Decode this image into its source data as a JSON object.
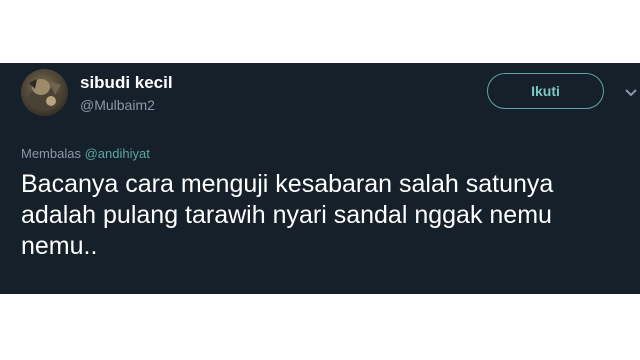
{
  "tweet": {
    "author": {
      "display_name": "sibudi kecil",
      "handle": "@Mulbaim2"
    },
    "follow_label": "Ikuti",
    "reply": {
      "label": "Membalas",
      "mention": "@andihiyat"
    },
    "text": "Bacanya cara menguji kesabaran salah satunya adalah pulang tarawih nyari sandal nggak nemu nemu..",
    "more_icon": "chevron-down-icon"
  },
  "colors": {
    "card_background": "#15202b",
    "accent": "#5ba6a0",
    "secondary_text": "#8899a6"
  }
}
